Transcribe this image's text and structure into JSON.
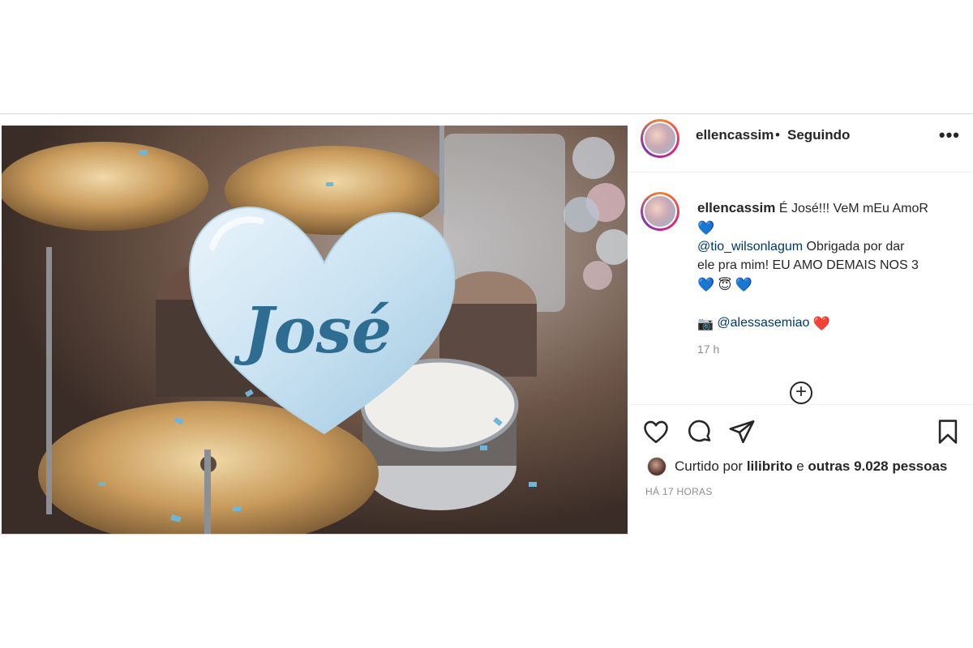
{
  "post": {
    "photo": {
      "balloon_text": "José"
    },
    "header": {
      "username": "ellencassim",
      "separator": "•",
      "follow_status": "Seguindo",
      "more_label": "•••"
    },
    "caption": {
      "username": "ellencassim",
      "text_1": "É José!!! VeM mEu AmoR",
      "heart_1": "💙",
      "mention_1": "@tio_wilsonlagum",
      "text_2": " Obrigada por dar",
      "text_3": "ele pra mim! EU AMO DEMAIS NOS 3",
      "emoji_row": [
        "💙",
        "😇",
        "💙"
      ],
      "camera": "📷",
      "mention_2": "@alessasemiao",
      "heart_red": "❤️",
      "time_ago": "17 h"
    },
    "plus_label": "+",
    "likes": {
      "prefix": "Curtido por ",
      "user": "lilibrito",
      "middle": " e ",
      "others": "outras 9.028 pessoas"
    },
    "timestamp": "HÁ 17 HORAS"
  },
  "colors": {
    "mention": "#00376b",
    "secondary_text": "#8e8e8e",
    "border": "#dbdbdb"
  },
  "icons": [
    "heart-outline-icon",
    "comment-icon",
    "share-icon",
    "bookmark-icon",
    "more-options-icon",
    "add-icon",
    "camera-icon"
  ]
}
